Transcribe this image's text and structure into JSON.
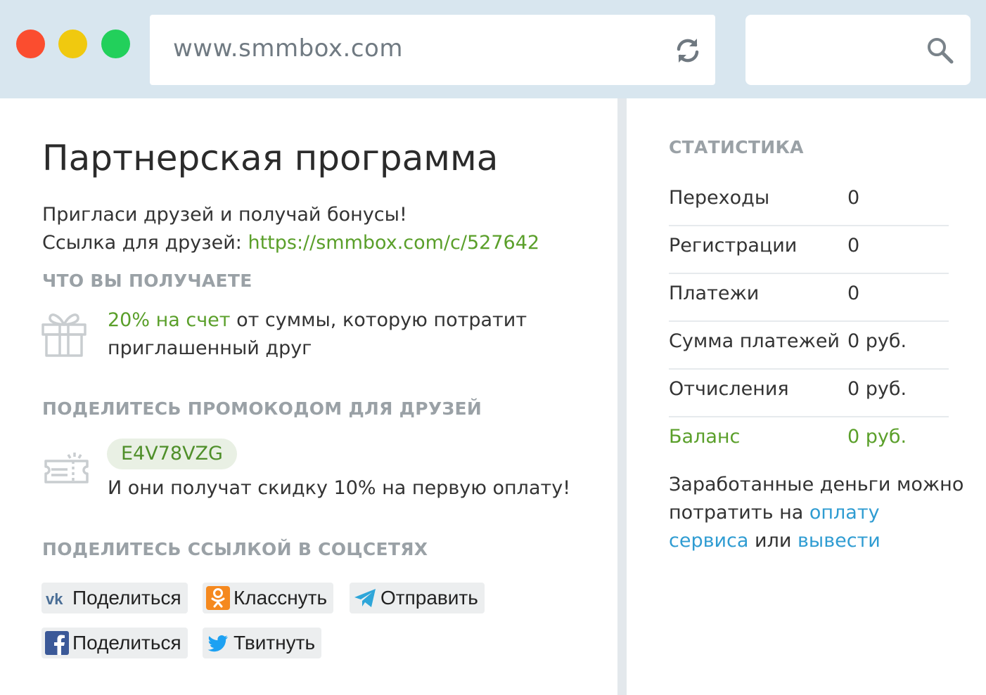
{
  "browser": {
    "url": "www.smmbox.com"
  },
  "page": {
    "title": "Партнерская программа",
    "intro_line1": "Пригласи друзей и получай бонусы!",
    "link_label": "Ссылка для друзей: ",
    "link_url": "https://smmbox.com/c/527642"
  },
  "benefit": {
    "heading": "ЧТО ВЫ ПОЛУЧАЕТЕ",
    "highlight": "20% на счет",
    "text_rest": " от суммы, которую потратит",
    "text_line2": "приглашенный друг"
  },
  "promo": {
    "heading": "ПОДЕЛИТЕСЬ ПРОМОКОДОМ ДЛЯ ДРУЗЕЙ",
    "code": "E4V78VZG",
    "note": "И они получат скидку 10% на первую оплату!"
  },
  "share": {
    "heading": "ПОДЕЛИТЕСЬ ССЫЛКОЙ В СОЦСЕТЯХ",
    "vk_label": "Поделиться",
    "ok_label": "Класснуть",
    "telegram_label": "Отправить",
    "fb_label": "Поделиться",
    "twitter_label": "Твитнуть"
  },
  "stats": {
    "heading": "СТАТИСТИКА",
    "rows": [
      {
        "label": "Переходы",
        "value": "0"
      },
      {
        "label": "Регистрации",
        "value": "0"
      },
      {
        "label": "Платежи",
        "value": "0"
      },
      {
        "label": "Сумма платежей",
        "value": "0 руб."
      },
      {
        "label": "Отчисления",
        "value": "0 руб."
      },
      {
        "label": "Баланс",
        "value": "0 руб."
      }
    ],
    "earn_text1": "Заработанные деньги можно потратить на ",
    "earn_link1": "оплату сервиса",
    "earn_text2": " или ",
    "earn_link2": "вывести"
  },
  "colors": {
    "accent_green": "#5a9f2a",
    "link_blue": "#2f9cd2",
    "chrome_bg": "#d8e6ef"
  }
}
